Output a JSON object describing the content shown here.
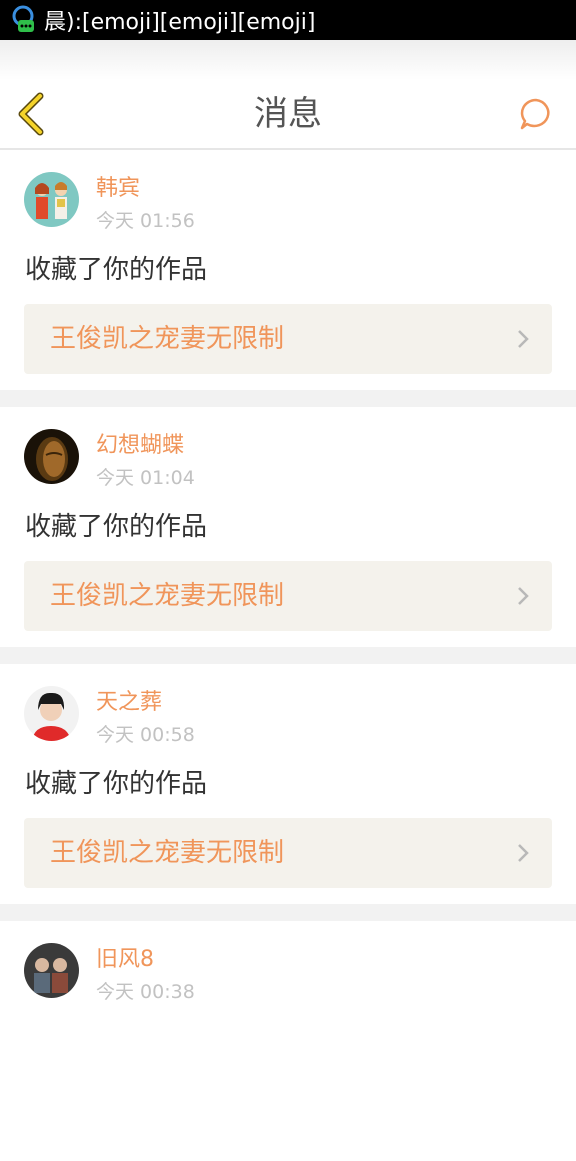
{
  "status_bar": {
    "text": "晨):[emoji][emoji][emoji]",
    "icon": "notification-chat-icon"
  },
  "header": {
    "title": "消息",
    "back_icon": "chevron-left-icon",
    "chat_icon": "chat-bubble-icon",
    "accent_color": "#f0955a"
  },
  "messages": [
    {
      "user": "韩宾",
      "time": "今天 01:56",
      "action": "收藏了你的作品",
      "work": "王俊凯之宠妻无限制"
    },
    {
      "user": "幻想蝴蝶",
      "time": "今天 01:04",
      "action": "收藏了你的作品",
      "work": "王俊凯之宠妻无限制"
    },
    {
      "user": "天之葬",
      "time": "今天 00:58",
      "action": "收藏了你的作品",
      "work": "王俊凯之宠妻无限制"
    },
    {
      "user": "旧风8",
      "time": "今天 00:38"
    }
  ]
}
